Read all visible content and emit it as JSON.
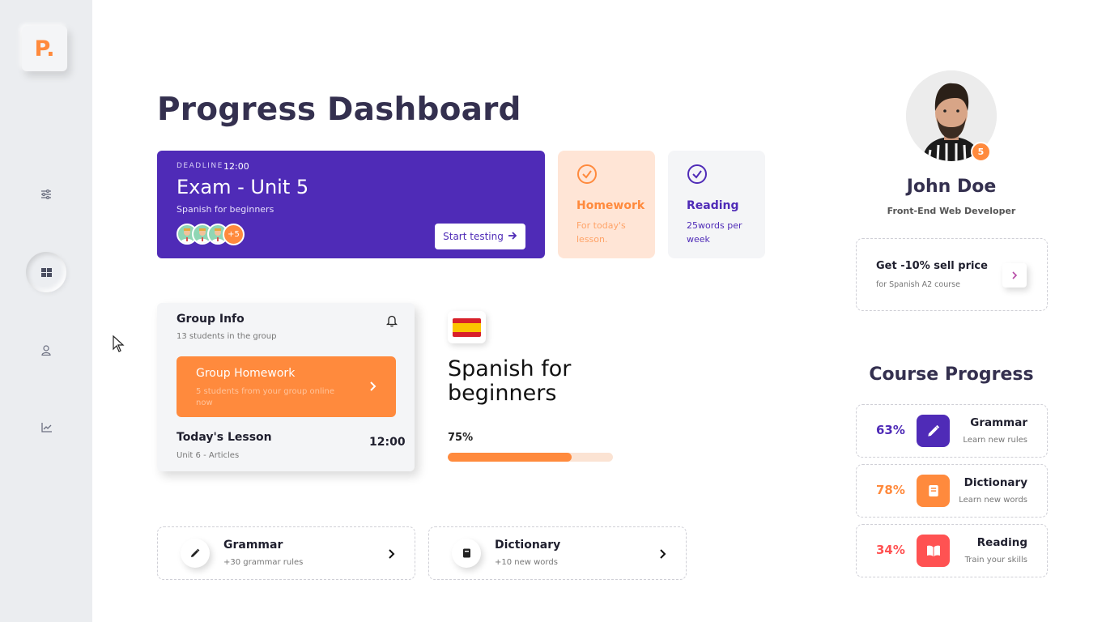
{
  "sidebar": {
    "logo": "P.",
    "items": [
      {
        "icon": "sliders-icon"
      },
      {
        "icon": "dashboard-grid-icon",
        "active": true
      },
      {
        "icon": "user-icon"
      },
      {
        "icon": "chart-icon"
      }
    ]
  },
  "colors": {
    "accent_orange": "#ff8a3d",
    "accent_purple": "#4f2bb7",
    "reading_red": "#ff5252"
  },
  "header": {
    "title": "Progress Dashboard"
  },
  "exam": {
    "deadline_label": "DEADLINE",
    "deadline_time": "12:00",
    "title": "Exam - Unit 5",
    "subtitle": "Spanish for beginners",
    "more_participants": "+5",
    "start_button": "Start testing"
  },
  "homework": {
    "title": "Homework",
    "subtitle": "For today's lesson."
  },
  "reading": {
    "title": "Reading",
    "subtitle": "25words per week"
  },
  "group": {
    "title": "Group Info",
    "subtitle": "13 students in the group",
    "homework_title": "Group Homework",
    "homework_subtitle": "5 students from your group online now",
    "lesson_title": "Today's Lesson",
    "lesson_subtitle": "Unit 6 - Articles",
    "lesson_time": "12:00"
  },
  "course": {
    "title": "Spanish for beginners",
    "progress_label": "75%",
    "progress": 0.75
  },
  "bottom_cards": [
    {
      "title": "Grammar",
      "subtitle": "+30 grammar rules",
      "icon": "pencil-icon"
    },
    {
      "title": "Dictionary",
      "subtitle": "+10 new words",
      "icon": "book-icon"
    }
  ],
  "profile": {
    "name": "John Doe",
    "role": "Front-End Web Developer",
    "badge": "5"
  },
  "promo": {
    "title": "Get -10% sell price",
    "subtitle": "for Spanish A2 course"
  },
  "course_progress": {
    "title": "Course Progress",
    "items": [
      {
        "percent": "63%",
        "name": "Grammar",
        "subtitle": "Learn new rules",
        "color": "#4f2bb7",
        "icon": "pencil-icon"
      },
      {
        "percent": "78%",
        "name": "Dictionary",
        "subtitle": "Learn new words",
        "color": "#ff8a3d",
        "icon": "book-icon"
      },
      {
        "percent": "34%",
        "name": "Reading",
        "subtitle": "Train your skills",
        "color": "#ff5252",
        "icon": "open-book-icon"
      }
    ]
  }
}
